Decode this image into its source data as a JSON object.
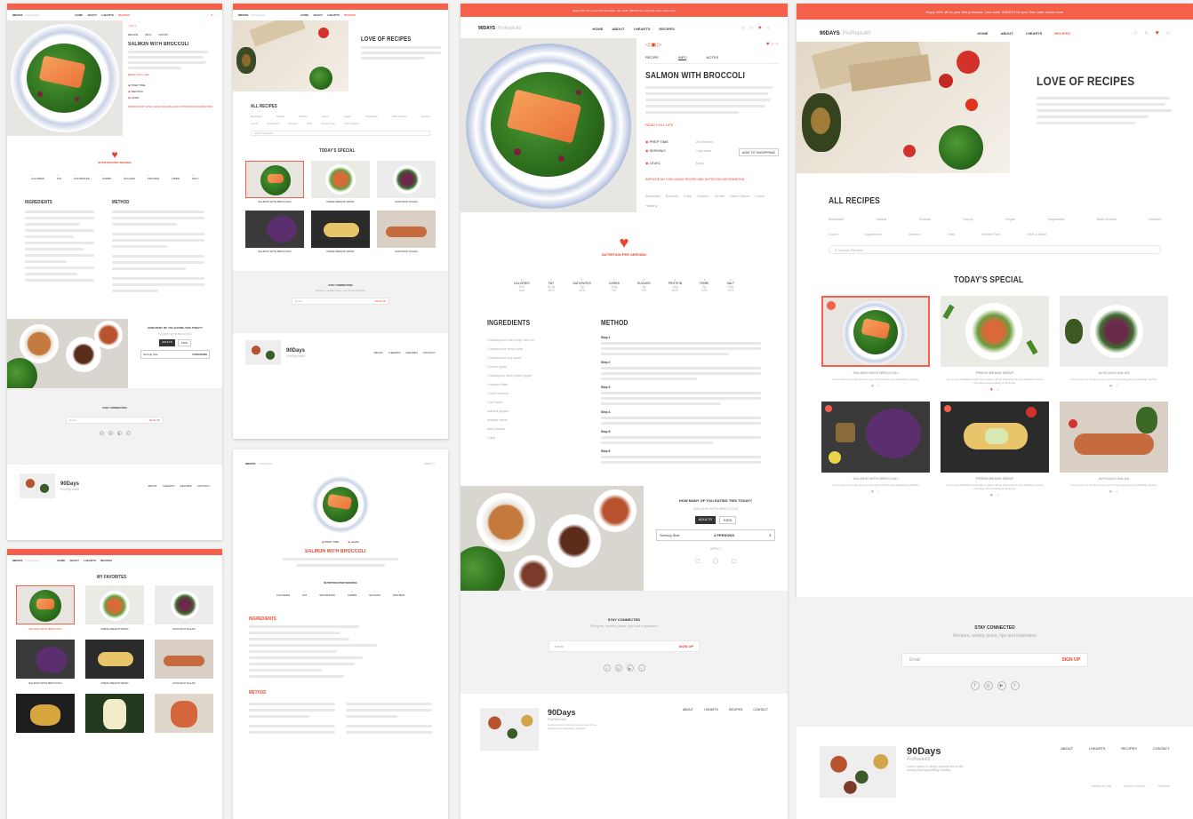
{
  "brand": {
    "name": "90DAYS",
    "sub": "ProReplu60",
    "accent": "#f4604a"
  },
  "topbar": {
    "text": "Enjoy 20% off on your first purchase. Use code: 90DAYS for your first order  Learn more"
  },
  "nav": {
    "items": [
      "HOME",
      "ABOUT",
      "I.HEARTS",
      "RECIPES"
    ]
  },
  "recipe": {
    "title": "SALMON WITH BROCCOLI",
    "tabs": [
      "RECIPE",
      "INFO",
      "NOTES"
    ],
    "read_more": "READ FULL LIFE",
    "meta": [
      {
        "label": "PREP TIME",
        "value": "20 minutes"
      },
      {
        "label": "SERVING",
        "value": "4 persons"
      },
      {
        "label": "LEVEL",
        "value": "Easy"
      }
    ],
    "meta_button": "ADD TO SHOPPING",
    "warning": "IMPROVE MY DISH USING RECIPE AND NUTRITION INFORMATION",
    "tags": [
      "Breakfast",
      "Broccoli",
      "Easy",
      "Salmon",
      "Dinner",
      "Main Dishes",
      "Lunch",
      "Healthy"
    ]
  },
  "nutrition": {
    "title": "NUTRITION PER SERVING",
    "items": [
      {
        "label": "CALORIES",
        "value": "525",
        "unit": "kcal"
      },
      {
        "label": "FAT",
        "value": "18.2g",
        "unit": "28%"
      },
      {
        "label": "SATURATES",
        "value": "3g",
        "unit": "15%"
      },
      {
        "label": "CARBS",
        "value": "8.4g",
        "unit": "3%"
      },
      {
        "label": "SUGARS",
        "value": "2g",
        "unit": "2%"
      },
      {
        "label": "PROTEIN",
        "value": "42g",
        "unit": "84%"
      },
      {
        "label": "FIBRE",
        "value": "5g",
        "unit": "20%"
      },
      {
        "label": "SALT",
        "value": "0.8g",
        "unit": "13%"
      }
    ]
  },
  "ingredients": {
    "title": "INGREDIENTS",
    "items": [
      "4 tablespoons extra virgin olive oil",
      "2 tablespoons lemon juice",
      "2 tablespoons soy sauce",
      "2 cloves garlic",
      "1 tablespoon fresh grated ginger",
      "4 salmon fillets",
      "1 head broccoli",
      "1 red onion",
      "salt and pepper",
      "sesame seeds",
      "fresh parsley",
      "1 lime"
    ]
  },
  "method": {
    "title": "METHOD",
    "steps": [
      "Step 1",
      "Step 2",
      "Step 3",
      "Step 4",
      "Step 5",
      "Step 6"
    ]
  },
  "eating": {
    "title": "HOW MANY OF YOU EATING THIS TODAY?",
    "subtitle": "SALMON WITH BROCCOLI",
    "options": [
      "ADULTS",
      "KIDS"
    ],
    "serving_label": "Serving Size",
    "serving_value": "4 PERSONS",
    "extra": "APPLY"
  },
  "stay": {
    "title": "STAY CONNECTED",
    "subtitle": "Recipes, weekly plans, tips and inspiration",
    "placeholder": "Email",
    "button": "SIGN UP"
  },
  "footer": {
    "name": "90Days",
    "sub": "ProReplu60",
    "blurb": "Lorem Ipsum is simply dummy text of the printing and typesetting industry.",
    "links": [
      "ABOUT",
      "I.HEARTS",
      "RECIPES",
      "CONTACT"
    ],
    "legal": [
      "TERMS OF USE",
      "PRIVACY POLICY",
      "SITEMAP"
    ]
  },
  "hero": {
    "title": "LOVE OF RECIPES",
    "text": "ProReplu60 is a healthy recipe website where you can find inspiration for your everyday cooking, nutrition and well-being. Our recipes are created by nutrition experts and are easy to follow."
  },
  "all_recipes": {
    "title": "ALL RECIPES",
    "categories": [
      "Breakfast",
      "Salads",
      "Snacks",
      "Soups",
      "Vegan",
      "Vegetarian",
      "Main Dishes",
      "Dessert",
      "Lunch",
      "Appetizers",
      "Dinners",
      "Tarts",
      "Gluten Free",
      "Fish & Meat"
    ],
    "search_placeholder": "Search Recipes"
  },
  "today": {
    "title": "TODAY'S SPECIAL",
    "cards": [
      {
        "title": "SALMON WITH BROCCOLI",
        "desc": "Lorem Ipsum is simply dummy text of the printing and typesetting industry."
      },
      {
        "title": "FRESH BEANS WRAP",
        "desc": "It is a long established fact that a reader will be distracted by the readable content of a page when looking at its layout."
      },
      {
        "title": "AVOCADO SALAD",
        "desc": "Lorem Ipsum is simply dummy text of the printing and typesetting industry."
      },
      {
        "title": "SALMON WITH BROCCOLI",
        "desc": "Lorem Ipsum is simply dummy text of the printing and typesetting industry."
      },
      {
        "title": "FRESH BEANS WRAP",
        "desc": "It is a long established fact that a reader will be distracted by the readable content of a page when looking at its layout."
      },
      {
        "title": "AVOCADO SALAD",
        "desc": "Lorem Ipsum is simply dummy text of the printing and typesetting industry."
      }
    ]
  },
  "favourites": {
    "title": "MY FAVORITES"
  }
}
